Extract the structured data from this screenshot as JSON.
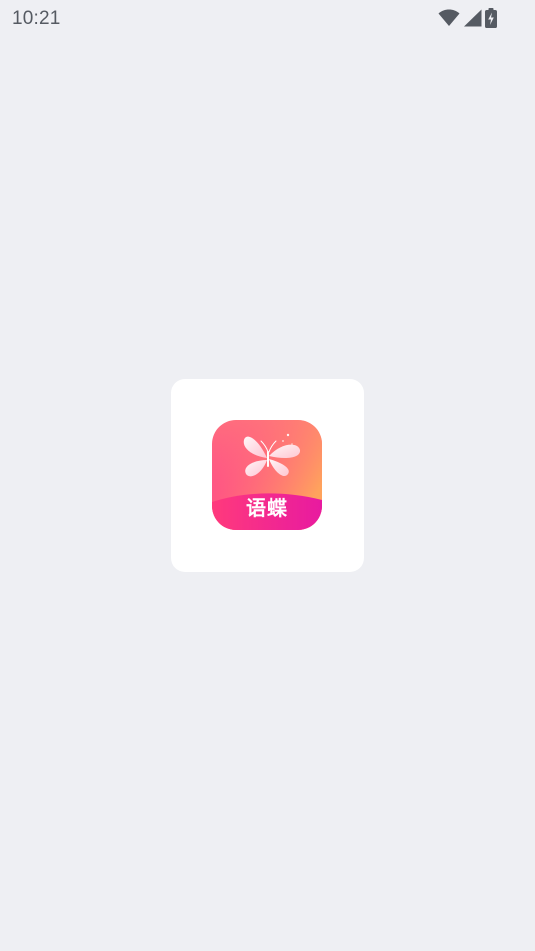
{
  "status_bar": {
    "time": "10:21",
    "icons": [
      "wifi-icon",
      "signal-icon",
      "battery-charging-icon"
    ],
    "icon_color": "#555a62"
  },
  "splash": {
    "background_color": "#eeeff3",
    "card_color": "#ffffff",
    "app_icon": {
      "label": "语蝶",
      "icon": "butterfly-icon",
      "gradient": [
        "#ff6e7d",
        "#ffa05a",
        "#ff3a8c",
        "#e91e8c"
      ]
    }
  }
}
